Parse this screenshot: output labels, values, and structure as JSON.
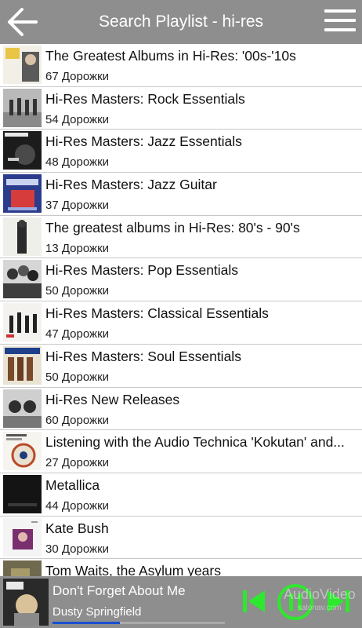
{
  "header": {
    "title": "Search Playlist - hi-res"
  },
  "playlists": [
    {
      "title": "The Greatest Albums in Hi-Res: '00s-'10s",
      "count": "67 Дорожки"
    },
    {
      "title": "Hi-Res Masters: Rock Essentials",
      "count": "54 Дорожки"
    },
    {
      "title": "Hi-Res Masters: Jazz Essentials",
      "count": "48 Дорожки"
    },
    {
      "title": "Hi-Res Masters: Jazz Guitar",
      "count": "37 Дорожки"
    },
    {
      "title": "The greatest albums in Hi-Res: 80's - 90's",
      "count": "13 Дорожки"
    },
    {
      "title": "Hi-Res Masters: Pop Essentials",
      "count": "50 Дорожки"
    },
    {
      "title": "Hi-Res Masters: Classical Essentials",
      "count": "47 Дорожки"
    },
    {
      "title": "Hi-Res Masters: Soul Essentials",
      "count": "50 Дорожки"
    },
    {
      "title": "Hi-Res New Releases",
      "count": "60 Дорожки"
    },
    {
      "title": "Listening with the Audio Technica 'Kokutan' and...",
      "count": "27 Дорожки"
    },
    {
      "title": "Metallica",
      "count": "44 Дорожки"
    },
    {
      "title": "Kate Bush",
      "count": "30 Дорожки"
    },
    {
      "title": "Tom Waits, the Asylum years",
      "count": ""
    }
  ],
  "now_playing": {
    "track": "Don't Forget About Me",
    "artist": "Dusty Springfield",
    "progress": 0.39,
    "watermark_line1": "AudioVideo",
    "watermark_line2": "salonav.com"
  },
  "colors": {
    "bar": "#8e8e8e",
    "accent": "#2ee82e",
    "progress": "#1a4fd0"
  }
}
